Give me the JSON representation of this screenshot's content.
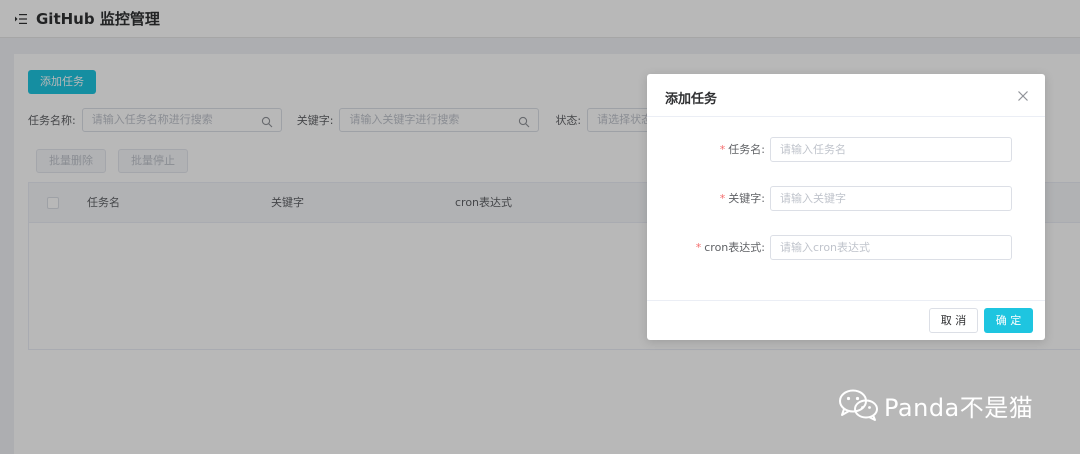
{
  "header": {
    "title": "GitHub 监控管理",
    "menu_icon": "menu-fold-icon"
  },
  "toolbar": {
    "add_task_label": "添加任务"
  },
  "filters": {
    "task_name_label": "任务名称:",
    "task_name_placeholder": "请输入任务名称进行搜索",
    "keyword_label": "关键字:",
    "keyword_placeholder": "请输入关键字进行搜索",
    "status_label": "状态:",
    "status_placeholder": "请选择状态"
  },
  "batch": {
    "delete_label": "批量删除",
    "stop_label": "批量停止"
  },
  "table": {
    "columns": [
      "任务名",
      "关键字",
      "cron表达式"
    ]
  },
  "dialog": {
    "title": "添加任务",
    "fields": [
      {
        "label": "任务名:",
        "placeholder": "请输入任务名",
        "required": "*"
      },
      {
        "label": "关键字:",
        "placeholder": "请输入关键字",
        "required": "*"
      },
      {
        "label": "cron表达式:",
        "placeholder": "请输入cron表达式",
        "required": "*"
      }
    ],
    "cancel_label": "取 消",
    "ok_label": "确 定"
  },
  "watermark": {
    "text": "Panda不是猫"
  },
  "colors": {
    "primary": "#1ec5e0",
    "required": "#f56c6c"
  }
}
